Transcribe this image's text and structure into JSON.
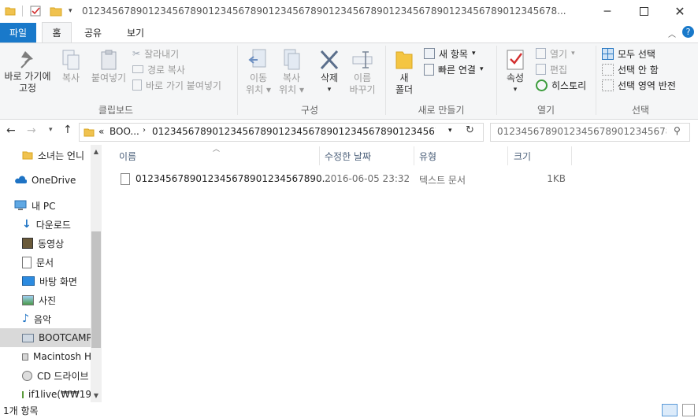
{
  "window": {
    "title": "0123456789012345678901234567890123456789012345678901234567890123456789012345678...",
    "minimize_icon": "minimize-icon",
    "maximize_icon": "maximize-icon",
    "close_icon": "close-icon"
  },
  "ribbon_tabs": {
    "file": "파일",
    "home": "홈",
    "share": "공유",
    "view": "보기"
  },
  "clipboard": {
    "pin_label_1": "바로 가기에",
    "pin_label_2": "고정",
    "copy": "복사",
    "paste": "붙여넣기",
    "cut": "잘라내기",
    "copy_path": "경로 복사",
    "paste_shortcut": "바로 가기 붙여넣기",
    "group": "클립보드"
  },
  "organize": {
    "move_to_1": "이동",
    "move_to_2": "위치",
    "copy_to_1": "복사",
    "copy_to_2": "위치",
    "delete": "삭제",
    "rename_1": "이름",
    "rename_2": "바꾸기",
    "group": "구성"
  },
  "new": {
    "new_folder_1": "새",
    "new_folder_2": "폴더",
    "new_item": "새 항목",
    "easy_access": "빠른 연결",
    "group": "새로 만들기"
  },
  "open": {
    "properties": "속성",
    "open": "열기",
    "edit": "편집",
    "history": "히스토리",
    "group": "열기"
  },
  "select": {
    "select_all": "모두 선택",
    "select_none": "선택 안 함",
    "invert": "선택 영역 반전",
    "group": "선택"
  },
  "address": {
    "prefix": "«",
    "crumb1": "BOO...",
    "crumb2": "0123456789012345678901234567890123456789012345678901234567890123456...",
    "search_placeholder": "0123456789012345678901234567890123456789012345678..."
  },
  "nav": {
    "items": [
      {
        "label": "소녀는 언니",
        "icon": "folder-icon"
      },
      {
        "label": "OneDrive",
        "icon": "onedrive-icon"
      },
      {
        "label": "내 PC",
        "icon": "pc-icon"
      },
      {
        "label": "다운로드",
        "icon": "download-icon"
      },
      {
        "label": "동영상",
        "icon": "video-icon"
      },
      {
        "label": "문서",
        "icon": "document-icon"
      },
      {
        "label": "바탕 화면",
        "icon": "desktop-icon"
      },
      {
        "label": "사진",
        "icon": "pictures-icon"
      },
      {
        "label": "음악",
        "icon": "music-icon"
      },
      {
        "label": "BOOTCAMP",
        "icon": "drive-icon"
      },
      {
        "label": "Macintosh H",
        "icon": "drive-icon"
      },
      {
        "label": "CD 드라이브",
        "icon": "cd-icon"
      },
      {
        "label": "if1live(₩₩19",
        "icon": "network-drive-icon"
      }
    ]
  },
  "columns": {
    "name": "이름",
    "modified": "수정한 날짜",
    "type": "유형",
    "size": "크기"
  },
  "files": [
    {
      "name": "0123456789012345678901234567890...",
      "modified": "2016-06-05 23:32",
      "type": "텍스트 문서",
      "size": "1KB"
    }
  ],
  "status": {
    "count": "1개 항목"
  }
}
